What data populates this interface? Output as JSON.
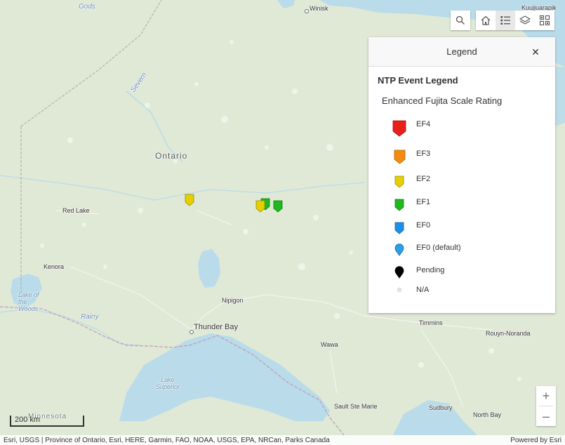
{
  "map": {
    "places": [
      {
        "key": "winisk",
        "text": "Winisk"
      },
      {
        "key": "gods",
        "text": "Gods"
      },
      {
        "key": "kuujjuarapik",
        "text": "Kuujjuarapik"
      },
      {
        "key": "severn",
        "text": "Severn"
      },
      {
        "key": "ontario",
        "text": "Ontario"
      },
      {
        "key": "redlake",
        "text": "Red Lake"
      },
      {
        "key": "kenora",
        "text": "Kenora"
      },
      {
        "key": "lakeofthewoods",
        "text": "Lake of the Woods"
      },
      {
        "key": "rainy",
        "text": "Rainy"
      },
      {
        "key": "nipigon",
        "text": "Nipigon"
      },
      {
        "key": "thunderbay",
        "text": "Thunder Bay"
      },
      {
        "key": "lakesuperior",
        "text": "Lake Superior"
      },
      {
        "key": "minnesota",
        "text": "Minnesota"
      },
      {
        "key": "wawa",
        "text": "Wawa"
      },
      {
        "key": "timmins",
        "text": "Timmins"
      },
      {
        "key": "rouyn",
        "text": "Rouyn-Noranda"
      },
      {
        "key": "saultstemarie",
        "text": "Sault Ste Marie"
      },
      {
        "key": "sudbury",
        "text": "Sudbury"
      },
      {
        "key": "northbay",
        "text": "North Bay"
      }
    ],
    "markers": [
      {
        "rating": "EF2",
        "color": "#e6cf00"
      },
      {
        "rating": "EF1",
        "color": "#1fb81f"
      },
      {
        "rating": "EF2",
        "color": "#e6cf00"
      },
      {
        "rating": "EF1",
        "color": "#1fb81f"
      }
    ]
  },
  "toolbar": {
    "search_icon": "search-icon",
    "home_icon": "home-icon",
    "legend_icon": "legend-list-icon",
    "layers_icon": "layers-icon",
    "basemap_icon": "basemap-gallery-icon"
  },
  "legend": {
    "panel_title": "Legend",
    "close_symbol": "✕",
    "layer_title": "NTP Event Legend",
    "field_title": "Enhanced Fujita Scale Rating",
    "items": [
      {
        "label": "EF4",
        "color": "#e8201b",
        "shape": "pin-large"
      },
      {
        "label": "EF3",
        "color": "#f28c0f",
        "shape": "pin-medium"
      },
      {
        "label": "EF2",
        "color": "#e6cf00",
        "shape": "pin-small"
      },
      {
        "label": "EF1",
        "color": "#1fb81f",
        "shape": "pin-small"
      },
      {
        "label": "EF0",
        "color": "#1e8fe6",
        "shape": "pin-small"
      },
      {
        "label": "EF0 (default)",
        "color": "#2a9fe8",
        "shape": "drop"
      },
      {
        "label": "Pending",
        "color": "#000000",
        "shape": "drop"
      },
      {
        "label": "N/A",
        "color": "#e3e3e3",
        "shape": "dot"
      }
    ]
  },
  "zoom": {
    "in_label": "+",
    "out_label": "–"
  },
  "scalebar": {
    "label": "200 km"
  },
  "attribution": {
    "sources": "Esri, USGS | Province of Ontario, Esri, HERE, Garmin, FAO, NOAA, USGS, EPA, NRCan, Parks Canada",
    "powered_by": "Powered by Esri"
  }
}
